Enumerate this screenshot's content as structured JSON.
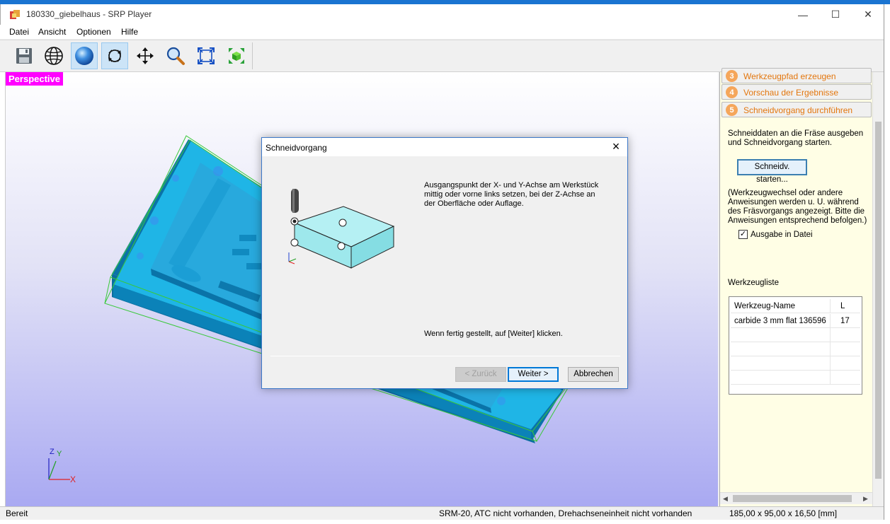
{
  "window": {
    "title": "180330_giebelhaus - SRP Player",
    "controls": {
      "minimize": "—",
      "maximize": "☐",
      "close": "✕"
    }
  },
  "menu": [
    "Datei",
    "Ansicht",
    "Optionen",
    "Hilfe"
  ],
  "toolbar": {
    "buttons": [
      {
        "name": "save",
        "icon": "floppy-icon"
      },
      {
        "name": "wireframe",
        "icon": "globe-wire-icon"
      },
      {
        "name": "shaded",
        "icon": "sphere-icon",
        "active": true
      },
      {
        "name": "rotate",
        "icon": "rotate-icon",
        "active": true
      },
      {
        "name": "pan",
        "icon": "move-icon"
      },
      {
        "name": "zoom",
        "icon": "magnifier-icon"
      },
      {
        "name": "fit",
        "icon": "fit-view-icon"
      },
      {
        "name": "zoom-box",
        "icon": "zoom-box-icon"
      }
    ]
  },
  "viewport": {
    "label": "Perspective",
    "axes": {
      "x": "X",
      "y": "Y",
      "z": "Z"
    }
  },
  "steps": [
    {
      "num": "3",
      "label": "Werkzeugpfad erzeugen"
    },
    {
      "num": "4",
      "label": "Vorschau der Ergebnisse"
    },
    {
      "num": "5",
      "label": "Schneidvorgang durchführen"
    }
  ],
  "panel": {
    "intro_line1": "Schneiddaten an die Fräse ausgeben",
    "intro_line2": "und Schneidvorgang starten.",
    "start_button": "Schneidv. starten...",
    "note_lines": [
      "(Werkzeugwechsel oder andere",
      "Anweisungen werden u. U. während",
      "des Fräsvorgangs angezeigt. Bitte die",
      "Anweisungen entsprechend befolgen.)"
    ],
    "checkbox_label": "Ausgabe in Datei",
    "checkbox_checked": true,
    "tool_list_title": "Werkzeugliste",
    "tool_table": {
      "headers": [
        "Werkzeug-Name",
        "L"
      ],
      "rows": [
        [
          "carbide 3 mm flat 136596",
          "17"
        ]
      ]
    }
  },
  "status": {
    "left": "Bereit",
    "middle": "SRM-20, ATC nicht vorhanden, Drehachseneinheit nicht vorhanden",
    "right": "185,00 x  95,00 x  16,50 [mm]"
  },
  "dialog": {
    "title": "Schneidvorgang",
    "instruction_lines": [
      "Ausgangspunkt der X- und Y-Achse am Werkstück",
      "mittig oder vorne links setzen, bei der Z-Achse an",
      "der Oberfläche oder Auflage."
    ],
    "hint": "Wenn fertig gestellt, auf [Weiter] klicken.",
    "buttons": {
      "back": "< Zurück",
      "next": "Weiter >",
      "cancel": "Abbrechen"
    }
  },
  "colors": {
    "accent": "#0078d7",
    "perspective_label": "#ff00ff",
    "step_text": "#e3760d",
    "panel_bg": "#fffee5",
    "model_cyan": "#1fb5e6",
    "model_dark": "#0a73a8"
  }
}
